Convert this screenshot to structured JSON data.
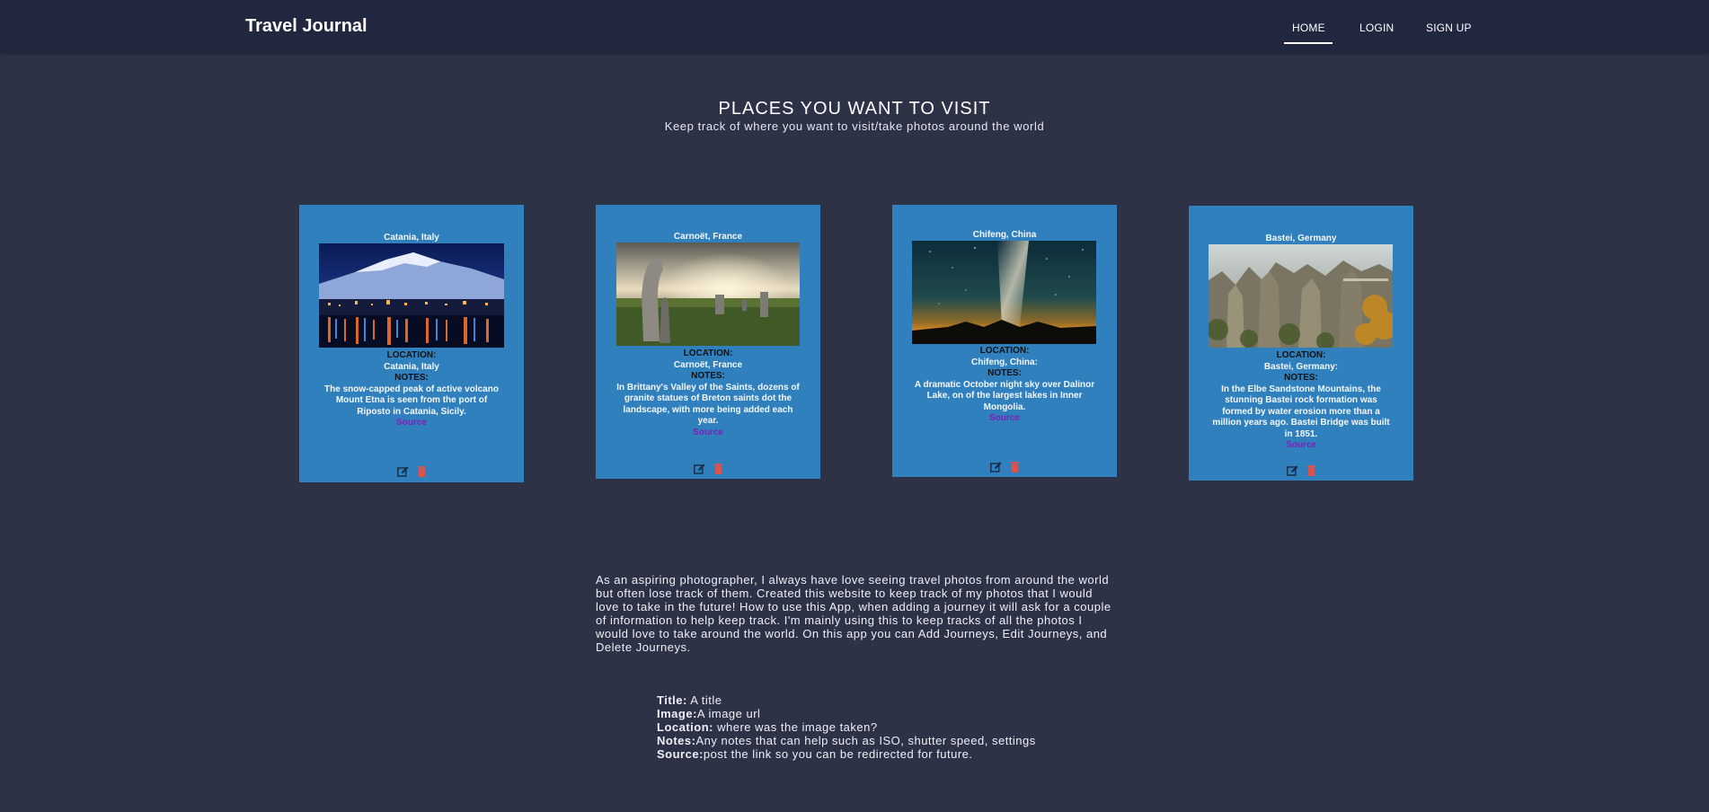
{
  "nav": {
    "brand": "Travel Journal",
    "items": [
      {
        "label": "HOME",
        "active": true
      },
      {
        "label": "LOGIN"
      },
      {
        "label": "SIGN UP"
      }
    ]
  },
  "hero": {
    "title": "PLACES YOU WANT TO VISIT",
    "subtitle": "Keep track of where you want to visit/take photos around the world"
  },
  "cards": [
    {
      "title": "Catania, Italy",
      "location_label": "LOCATION:",
      "location": "Catania, Italy",
      "notes_label": "NOTES:",
      "notes": "The snow-capped peak of active volcano Mount Etna is seen from the port of Riposto in Catania, Sicily.",
      "source": "Source"
    },
    {
      "title": "Carnoët, France",
      "location_label": "LOCATION:",
      "location": "Carnoët, France",
      "notes_label": "NOTES:",
      "notes": "In Brittany's Valley of the Saints, dozens of granite statues of Breton saints dot the landscape, with more being added each year.",
      "source": "Source"
    },
    {
      "title": "Chifeng, China",
      "location_label": "LOCATION:",
      "location": "Chifeng, China:",
      "notes_label": "NOTES:",
      "notes": "A dramatic October night sky over Dalinor Lake, on of the largest lakes in Inner Mongolia.",
      "source": "Source"
    },
    {
      "title": "Bastei, Germany",
      "location_label": "LOCATION:",
      "location": "Bastei, Germany:",
      "notes_label": "NOTES:",
      "notes": "In the Elbe Sandstone Mountains, the stunning Bastei rock formation was formed by water erosion more than a million years ago. Bastei Bridge was built in 1851.",
      "source": "Source"
    }
  ],
  "about": "As an aspiring photographer, I always have love seeing travel photos from around the world but often lose track of them. Created this website to keep track of my photos that I would love to take in the future! How to use this App, when adding a journey it will ask for a couple of information to help keep track. I'm mainly using this to keep tracks of all the photos I would love to take around the world. On this app you can Add Journeys, Edit Journeys, and Delete Journeys.",
  "instructions": [
    {
      "key": "Title:",
      "text": " A title"
    },
    {
      "key": "Image:",
      "text": "A image url"
    },
    {
      "key": "Location:",
      "text": " where was the image taken?"
    },
    {
      "key": "Notes:",
      "text": "Any notes that can help such as ISO, shutter speed, settings"
    },
    {
      "key": "Source:",
      "text": "post the link so you can be redirected for future."
    }
  ],
  "colors": {
    "background": "#2e3247",
    "navbar": "#222740",
    "card": "#2f80bd",
    "source_link": "#7b22b8",
    "trash_icon": "#d9534f"
  }
}
